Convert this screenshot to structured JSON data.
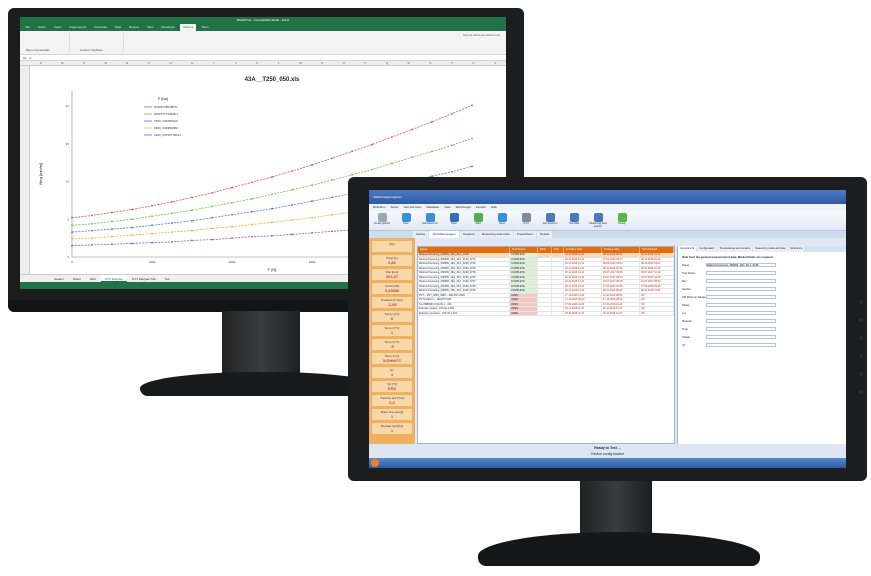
{
  "back_monitor": {
    "window_title": "BGM/PCal - Compatibility Mode - Excel",
    "ribbon_tabs": [
      "File",
      "Home",
      "Insert",
      "Page Layout",
      "Formulas",
      "Data",
      "Review",
      "View",
      "Developer",
      "Add-ins",
      "Team"
    ],
    "active_tab": "Add-ins",
    "tell_me": "Tell me what you want to do",
    "ribbon_groups": [
      "Menu Commands",
      "Custom Toolbars"
    ],
    "name_box": "A1",
    "formula_value": "fx",
    "columns": [
      "A",
      "B",
      "C",
      "D",
      "E",
      "F",
      "G",
      "H",
      "I",
      "J",
      "K",
      "L",
      "M",
      "N",
      "O",
      "P",
      "Q",
      "R",
      "S",
      "T",
      "U",
      "V"
    ],
    "chart_data": {
      "type": "line",
      "title": "43A__T250_050.xls",
      "xlabel": "F [N]",
      "ylabel": "Weg [mm/m]",
      "legend_title": "P [bar]",
      "legend_position": "top-left",
      "x": [
        0,
        250,
        500,
        750,
        1000,
        1250,
        1500,
        1750,
        2000,
        2250,
        2500,
        2750,
        3000,
        3250,
        3500,
        3750,
        4000,
        4250,
        4500,
        4750,
        5000
      ],
      "series": [
        {
          "name": "0040457B0480T1",
          "color": "#e05050",
          "values": [
            5.2,
            5.5,
            5.9,
            6.3,
            6.8,
            7.3,
            7.9,
            8.5,
            9.2,
            9.9,
            10.6,
            11.4,
            12.2,
            13.1,
            14.0,
            14.9,
            15.9,
            16.9,
            17.9,
            19.0,
            20.1
          ]
        },
        {
          "name": "0051577C0480L1",
          "color": "#6abf45",
          "values": [
            4.2,
            4.4,
            4.7,
            5.0,
            5.4,
            5.8,
            6.2,
            6.7,
            7.2,
            7.7,
            8.3,
            8.9,
            9.5,
            10.2,
            10.9,
            11.6,
            12.4,
            13.2,
            14.0,
            14.8,
            15.7
          ]
        },
        {
          "name": "1500_0493500A0",
          "color": "#4a7bd0",
          "values": [
            3.3,
            3.5,
            3.7,
            3.9,
            4.2,
            4.5,
            4.8,
            5.2,
            5.6,
            6.0,
            6.4,
            6.9,
            7.4,
            7.9,
            8.4,
            8.9,
            9.5,
            10.1,
            10.7,
            11.3,
            12.0
          ]
        },
        {
          "name": "1500_0493500B0",
          "color": "#f0b030",
          "values": [
            2.4,
            2.5,
            2.7,
            2.9,
            3.1,
            3.3,
            3.5,
            3.8,
            4.0,
            4.3,
            4.6,
            4.9,
            5.2,
            5.6,
            5.9,
            6.3,
            6.7,
            7.1,
            7.5,
            7.9,
            8.4
          ]
        },
        {
          "name": "1500_0475577B0L1",
          "color": "#a050c0",
          "values": [
            1.5,
            1.6,
            1.7,
            1.8,
            1.9,
            2.0,
            2.2,
            2.3,
            2.5,
            2.7,
            2.8,
            3.0,
            3.2,
            3.4,
            3.6,
            3.8,
            4.0,
            4.2,
            4.4,
            4.6,
            4.9
          ]
        }
      ],
      "ylim": [
        0,
        22
      ],
      "grid": false
    },
    "sheet_tabs": [
      "Header",
      "Daten",
      "Wert",
      "PVT Diagram",
      "PVT Diagram Tab",
      "Tab"
    ],
    "active_sheet": "PVT Diagram"
  },
  "front_monitor": {
    "window_title": "Selbstmessprogramm",
    "menu": [
      "Definition",
      "Setup",
      "Test-Services",
      "Database",
      "View",
      "Werkzeuge",
      "Fenster",
      "Hilfe"
    ],
    "toolbar": [
      {
        "label": "Create graphic",
        "color": "#9aa7b8"
      },
      {
        "label": "New",
        "color": "#3a8fdb"
      },
      {
        "label": "Data Records",
        "color": "#3a8fdb"
      },
      {
        "label": "Open",
        "color": "#2f6fb8"
      },
      {
        "label": "Start",
        "color": "#4caf50"
      },
      {
        "label": "Save",
        "color": "#3a8fdb"
      },
      {
        "label": "Print",
        "color": "#7a8aa0"
      },
      {
        "label": "Test Graphics",
        "color": "#4a79c4"
      },
      {
        "label": "Test Data",
        "color": "#4a79c4"
      },
      {
        "label": "Measuring data graphic",
        "color": "#4a79c4"
      },
      {
        "label": "Ready",
        "color": "#52b848"
      }
    ],
    "tabs": [
      "Setting",
      "Tests/Messungen",
      "Graphics",
      "Measuring data table",
      "PowerMeter",
      "Details"
    ],
    "active_tab": "Tests/Messungen",
    "left_panel": [
      {
        "label": "Stop",
        "value": ""
      },
      {
        "label": "Press [s]",
        "value": "2,80"
      },
      {
        "label": "Run [mm]",
        "value": "392,37"
      },
      {
        "label": "Current [N]",
        "value": "3,43850"
      },
      {
        "label": "Pressure Pr [bar]",
        "value": "-1,93"
      },
      {
        "label": "Temp 1 [°C]",
        "value": "0"
      },
      {
        "label": "Temp 2 [°C]",
        "value": "1"
      },
      {
        "label": "Temp 3 [°C]",
        "value": "-9"
      },
      {
        "label": "Temp 4 [°C]",
        "value": "3-OHM/°C"
      },
      {
        "label": "Hz",
        "value": "1"
      },
      {
        "label": "Tol. [°C]",
        "value": "ESX"
      },
      {
        "label": "Traverse spd [°C/s]",
        "value": "0,0"
      },
      {
        "label": "Brace time spd [s]",
        "value": "1"
      },
      {
        "label": "Decoder spd [K/s]",
        "value": "1"
      }
    ],
    "grid_headers": [
      "Name",
      "Test Status",
      "Stnd.",
      "Run",
      "Creation date",
      "Change date",
      "Test finished"
    ],
    "grid_rows": [
      [
        "Referenzmessung_090450_19G_30-1_0128",
        "COMPLETE",
        "",
        "",
        "20.11.2016 14:11",
        "28.11.2016 08:41",
        "28.11.2016 15:12"
      ],
      [
        "Referenzmessung_090450_19G_30-1_0128_0718",
        "COMPLETE",
        "",
        "",
        "20.11.2016 14:11",
        "27.01.2016 09:17",
        "28.11.2016 15:12"
      ],
      [
        "Referenzmessung_090450_19G_30-1_0128_0718",
        "COMPLETE",
        "",
        "",
        "20.11.2016 14:11",
        "08.06.2016 06:04",
        "08.10.2016 19:21"
      ],
      [
        "Referenzmessung_090450_19G_30-1_0128_0718",
        "COMPLETE",
        "",
        "",
        "20.11.2016 14:11",
        "28.11.2016 18:12",
        "28.11.2016 15:12"
      ],
      [
        "Referenzmessung_090450_19G_30-1_0128_0718",
        "COMPLETE",
        "",
        "",
        "20.11.2016 14:11",
        "09.07.2017 09:46",
        "09.07.2017 11:12"
      ],
      [
        "Referenzmessung_090450_19G_30-1_0128_0718",
        "COMPLETE",
        "",
        "",
        "20.11.2016 14:11",
        "19.07.2017 08:15",
        "19.07.2017 13:46"
      ],
      [
        "Referenzmessung_090450_19G_30-1_0128_0717",
        "COMPLETE",
        "",
        "",
        "20.11.2016 14:11",
        "20.07.2017 08:15",
        "21.07.2017 08:42"
      ],
      [
        "Referenzmessung_090450_19G_30-1_0128_0718",
        "COMPLETE",
        "",
        "",
        "20.11.2016 14:11",
        "17.09.2016 10:46",
        "17.09.2016 09:46"
      ],
      [
        "Referenzmessung_090450_19G_30-1_0128_0718",
        "COMPLETE",
        "",
        "",
        "20.11.2016 14:11",
        "28.11.2016 08:41",
        "28.11.2016 14:33"
      ],
      [
        "PVT -- PVT_2045_4995 -- 460-PVT-2045",
        "OPEN",
        "",
        "",
        "17.10.2016 11:24",
        "11.10.2016 08:51",
        "OK"
      ],
      [
        "PVT-Isotherm - 160-PVT-003",
        "OPEN",
        "",
        "",
        "17.10.2016 08:12",
        "17.10.2016 08:12",
        "OK"
      ],
      [
        "Test MB0003 -100-30-1 - 001",
        "OPEN",
        "",
        "",
        "17.04.2016 11:24",
        "17.04.2016 11:24",
        "OK"
      ],
      [
        "Extrusion speed - 100-30-1-001",
        "OPEN",
        "",
        "",
        "20.11.2016 11:47",
        "20.11.2016 11:47",
        "OK"
      ],
      [
        "Extrusion pressure - 100-30-1-001",
        "OPEN",
        "",
        "",
        "20.11.2016 11:47",
        "20.11.2016 11:47",
        "OK"
      ]
    ],
    "right_tabs": [
      "General info",
      "Configuration",
      "Temperatures and sensors",
      "Measuring mode and data",
      "Reference"
    ],
    "right_note": "Data from the general measurement data. Marked fields are required.",
    "right_fields": [
      "Name",
      "Test Status",
      "Box",
      "Section",
      "UM Warmup Range",
      "Status",
      "Lot",
      "Material",
      "Time",
      "Global",
      "UT"
    ],
    "right_name_value": "Referenzmessung_090450_19G_30-1_0128",
    "status_line1": "Ready to Test ...",
    "status_line2": "Device config loaded",
    "colors": {
      "app_orange": "#e46c0a",
      "status_open": "#f4c7c3",
      "status_complete": "#dff0d8"
    }
  }
}
